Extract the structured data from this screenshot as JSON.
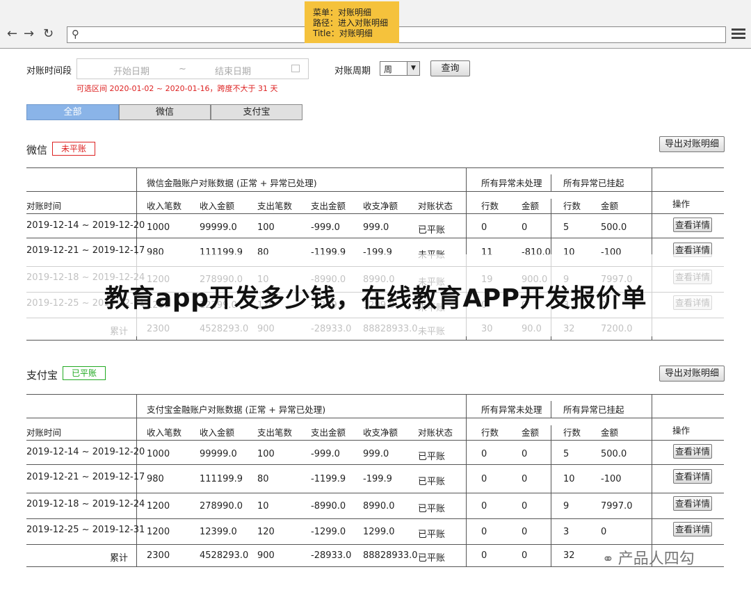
{
  "note": [
    "菜单：对账明细",
    "路径：进入对账明细",
    "Title：对账明细"
  ],
  "filter": {
    "period_label": "对账时间段",
    "start_placeholder": "开始日期",
    "tilde": "~",
    "end_placeholder": "结束日期",
    "hint": "可选区间 2020-01-02 ~ 2020-01-16，跨度不大于 31 天",
    "cycle_label": "对账周期",
    "cycle_value": "周",
    "query_button": "查询"
  },
  "tabs": [
    "全部",
    "微信",
    "支付宝"
  ],
  "header": {
    "group_wechat": "微信金融账户对账数据 (正常 + 异常已处理)",
    "group_alipay": "支付宝金融账户对账数据 (正常 + 异常已处理)",
    "group_unhandled": "所有异常未处理",
    "group_suspended": "所有异常已挂起",
    "columns": [
      "对账时间",
      "收入笔数",
      "收入金额",
      "支出笔数",
      "支出金额",
      "收支净额",
      "对账状态",
      "行数",
      "金额",
      "行数",
      "金额",
      "操作"
    ]
  },
  "wechat": {
    "title": "微信",
    "status": "未平账",
    "export_button": "导出对账明细",
    "rows": [
      [
        "2019-12-14 ~ 2019-12-20",
        "1000",
        "99999.0",
        "100",
        "-999.0",
        "999.0",
        "已平账",
        "0",
        "0",
        "5",
        "500.0"
      ],
      [
        "2019-12-21 ~ 2019-12-17",
        "980",
        "111199.9",
        "80",
        "-1199.9",
        "-199.9",
        "未平账",
        "11",
        "-810.0",
        "10",
        "-100"
      ],
      [
        "2019-12-18 ~ 2019-12-24",
        "1200",
        "278990.0",
        "10",
        "-8990.0",
        "8990.0",
        "未平账",
        "19",
        "900.0",
        "9",
        "7997.0"
      ],
      [
        "2019-12-25 ~ 2019-12-31",
        "1200",
        "12399.0",
        "120",
        "-1299.0",
        "1299.0",
        "未平账",
        "0",
        "0",
        "3",
        "0"
      ]
    ],
    "total": [
      "累计",
      "2300",
      "4528293.0",
      "900",
      "-28933.0",
      "88828933.0",
      "未平账",
      "30",
      "90.0",
      "32",
      "7200.0"
    ],
    "detail_button": "查看详情"
  },
  "alipay": {
    "title": "支付宝",
    "status": "已平账",
    "export_button": "导出对账明细",
    "rows": [
      [
        "2019-12-14 ~ 2019-12-20",
        "1000",
        "99999.0",
        "100",
        "-999.0",
        "999.0",
        "已平账",
        "0",
        "0",
        "5",
        "500.0"
      ],
      [
        "2019-12-21 ~ 2019-12-17",
        "980",
        "111199.9",
        "80",
        "-1199.9",
        "-199.9",
        "已平账",
        "0",
        "0",
        "10",
        "-100"
      ],
      [
        "2019-12-18 ~ 2019-12-24",
        "1200",
        "278990.0",
        "10",
        "-8990.0",
        "8990.0",
        "已平账",
        "0",
        "0",
        "9",
        "7997.0"
      ],
      [
        "2019-12-25 ~ 2019-12-31",
        "1200",
        "12399.0",
        "120",
        "-1299.0",
        "1299.0",
        "已平账",
        "0",
        "0",
        "3",
        "0"
      ]
    ],
    "total": [
      "累计",
      "2300",
      "4528293.0",
      "900",
      "-28933.0",
      "88828933.0",
      "已平账",
      "0",
      "0",
      "32",
      ""
    ],
    "detail_button": "查看详情"
  },
  "banner": "教育app开发多少钱，在线教育APP开发报价单",
  "watermark": "产品人四勾"
}
